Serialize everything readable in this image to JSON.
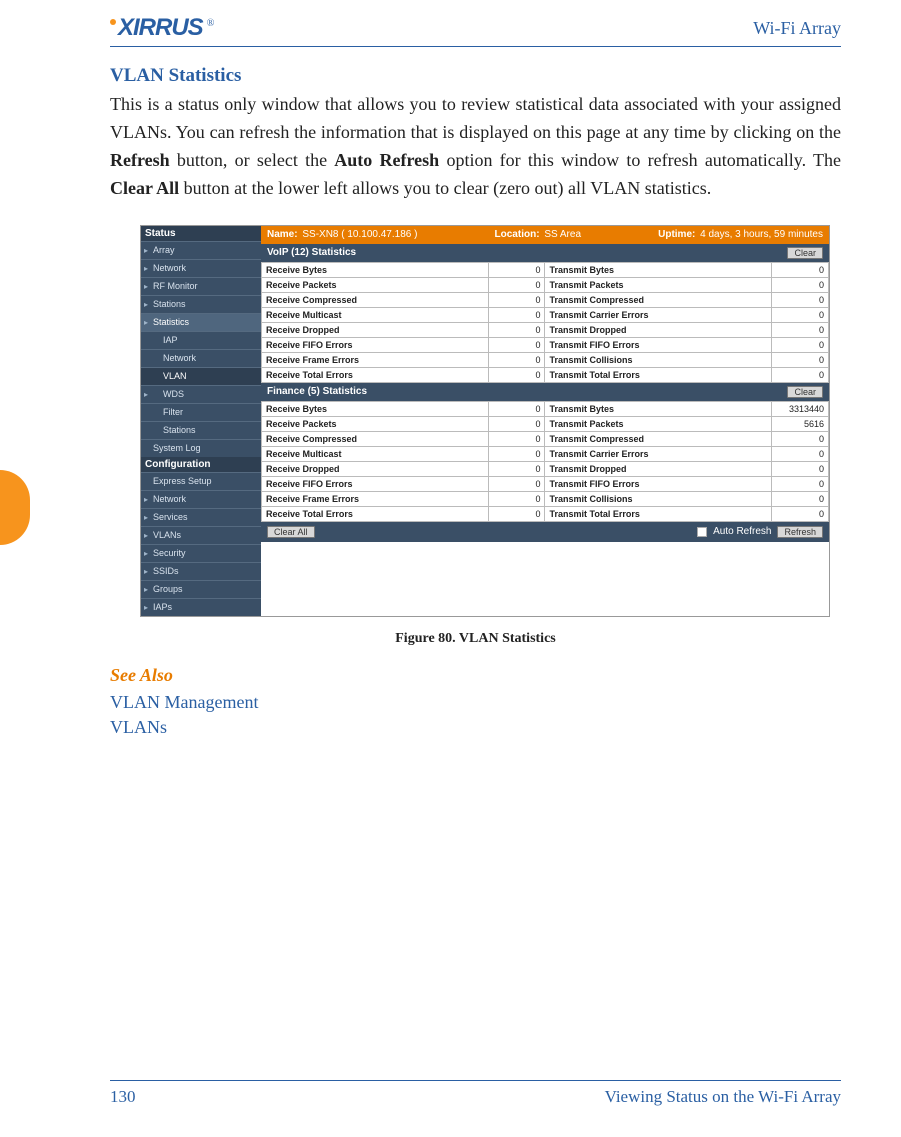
{
  "header": {
    "logo_text": "XIRRUS",
    "product": "Wi-Fi Array"
  },
  "section_title": "VLAN Statistics",
  "body_parts": {
    "p1": "This is a status only window that allows you to review statistical data associated with your assigned VLANs. You can refresh the information that is displayed on this page at any time by clicking on the ",
    "b1": "Refresh",
    "p2": " button, or select the ",
    "b2": "Auto Refresh",
    "p3": " option for this window to refresh automatically. The ",
    "b3": "Clear All",
    "p4": " button at the lower left allows you to clear (zero out) all VLAN statistics."
  },
  "screenshot": {
    "sidebar": {
      "status_header": "Status",
      "items": [
        "Array",
        "Network",
        "RF Monitor",
        "Stations",
        "Statistics"
      ],
      "stat_sub": [
        "IAP",
        "Network",
        "VLAN",
        "WDS",
        "Filter",
        "Stations"
      ],
      "system_log": "System Log",
      "config_header": "Configuration",
      "config_items": [
        "Express Setup",
        "Network",
        "Services",
        "VLANs",
        "Security",
        "SSIDs",
        "Groups",
        "IAPs"
      ]
    },
    "namebar": {
      "name_label": "Name:",
      "name_value": "SS-XN8   ( 10.100.47.186 )",
      "location_label": "Location:",
      "location_value": "SS Area",
      "uptime_label": "Uptime:",
      "uptime_value": "4 days, 3 hours, 59 minutes"
    },
    "sections": [
      {
        "title": "VoIP (12) Statistics",
        "clear": "Clear",
        "rows": [
          {
            "rl": "Receive Bytes",
            "rv": "0",
            "tl": "Transmit Bytes",
            "tv": "0"
          },
          {
            "rl": "Receive Packets",
            "rv": "0",
            "tl": "Transmit Packets",
            "tv": "0"
          },
          {
            "rl": "Receive Compressed",
            "rv": "0",
            "tl": "Transmit Compressed",
            "tv": "0"
          },
          {
            "rl": "Receive Multicast",
            "rv": "0",
            "tl": "Transmit Carrier Errors",
            "tv": "0"
          },
          {
            "rl": "Receive Dropped",
            "rv": "0",
            "tl": "Transmit Dropped",
            "tv": "0"
          },
          {
            "rl": "Receive FIFO Errors",
            "rv": "0",
            "tl": "Transmit FIFO Errors",
            "tv": "0"
          },
          {
            "rl": "Receive Frame Errors",
            "rv": "0",
            "tl": "Transmit Collisions",
            "tv": "0"
          },
          {
            "rl": "Receive Total Errors",
            "rv": "0",
            "tl": "Transmit Total Errors",
            "tv": "0"
          }
        ]
      },
      {
        "title": "Finance (5) Statistics",
        "clear": "Clear",
        "rows": [
          {
            "rl": "Receive Bytes",
            "rv": "0",
            "tl": "Transmit Bytes",
            "tv": "3313440"
          },
          {
            "rl": "Receive Packets",
            "rv": "0",
            "tl": "Transmit Packets",
            "tv": "5616"
          },
          {
            "rl": "Receive Compressed",
            "rv": "0",
            "tl": "Transmit Compressed",
            "tv": "0"
          },
          {
            "rl": "Receive Multicast",
            "rv": "0",
            "tl": "Transmit Carrier Errors",
            "tv": "0"
          },
          {
            "rl": "Receive Dropped",
            "rv": "0",
            "tl": "Transmit Dropped",
            "tv": "0"
          },
          {
            "rl": "Receive FIFO Errors",
            "rv": "0",
            "tl": "Transmit FIFO Errors",
            "tv": "0"
          },
          {
            "rl": "Receive Frame Errors",
            "rv": "0",
            "tl": "Transmit Collisions",
            "tv": "0"
          },
          {
            "rl": "Receive Total Errors",
            "rv": "0",
            "tl": "Transmit Total Errors",
            "tv": "0"
          }
        ]
      }
    ],
    "footer": {
      "clear_all": "Clear All",
      "auto_refresh": "Auto Refresh",
      "refresh": "Refresh"
    }
  },
  "caption": "Figure 80. VLAN Statistics",
  "see_also": "See Also",
  "links": {
    "l1": "VLAN Management",
    "l2": "VLANs"
  },
  "footer": {
    "page_num": "130",
    "chapter": "Viewing Status on the Wi-Fi Array"
  }
}
